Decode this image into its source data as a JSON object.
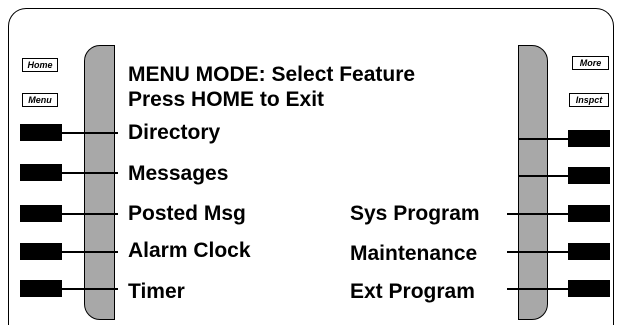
{
  "top_left_buttons": [
    "Home",
    "Menu"
  ],
  "top_right_buttons": [
    "More",
    "Inspct"
  ],
  "display": {
    "header_line1": "MENU MODE: Select Feature",
    "header_line2": "Press HOME to Exit",
    "left_items": [
      "Directory",
      "Messages",
      "Posted Msg",
      "Alarm Clock",
      "Timer"
    ],
    "right_items": [
      "Sys Program",
      "Maintenance",
      "Ext Program"
    ]
  }
}
